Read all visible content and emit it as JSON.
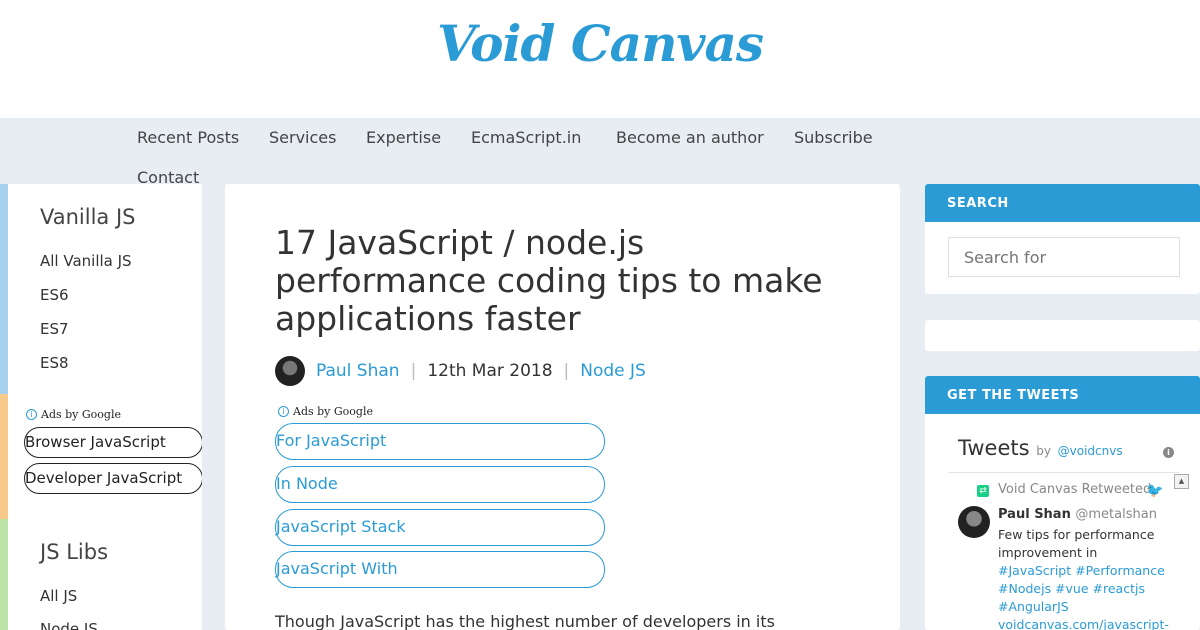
{
  "site": {
    "logo": "Void Canvas"
  },
  "nav": [
    "Recent Posts",
    "Services",
    "Expertise",
    "EcmaScript.in",
    "Become an author",
    "Subscribe",
    "Contact"
  ],
  "left_sidebar": {
    "section1_title": "Vanilla JS",
    "section1_links": [
      "All Vanilla JS",
      "ES6",
      "ES7",
      "ES8"
    ],
    "ads_label": "Ads by Google",
    "ad_buttons": [
      "Browser JavaScript",
      "Developer JavaScript"
    ],
    "section2_title": "JS Libs",
    "section2_links": [
      "All JS",
      "Node JS"
    ],
    "bar_colors": [
      "#a7cfee",
      "#f7c98a",
      "#bde3a6"
    ]
  },
  "article": {
    "title": "17 JavaScript / node.js performance coding tips to make applications faster",
    "author": "Paul Shan",
    "date": "12th Mar 2018",
    "category": "Node JS",
    "ads_label": "Ads by Google",
    "ad_buttons": [
      "For JavaScript",
      "In Node",
      "JavaScript Stack",
      "JavaScript With"
    ],
    "body_start": "Though JavaScript has the highest number of developers in its"
  },
  "search_widget": {
    "heading": "SEARCH",
    "placeholder": "Search for"
  },
  "tweets_widget": {
    "heading": "GET THE TWEETS",
    "title": "Tweets",
    "by": "by",
    "account": "@voidcnvs",
    "retweet_label": "Void Canvas Retweeted",
    "tweet": {
      "name": "Paul Shan",
      "handle": "@metalshan",
      "text_line1": "Few tips for performance",
      "text_line2": "improvement in",
      "hashtags_line1": "#JavaScript #Performance",
      "hashtags_line2": "#Nodejs #vue #reactjs",
      "hashtags_line3": "#AngularJS",
      "link": "voidcanvas.com/javascript-"
    }
  },
  "colors": {
    "accent": "#2a9bd5",
    "background": "#e7edf3"
  }
}
